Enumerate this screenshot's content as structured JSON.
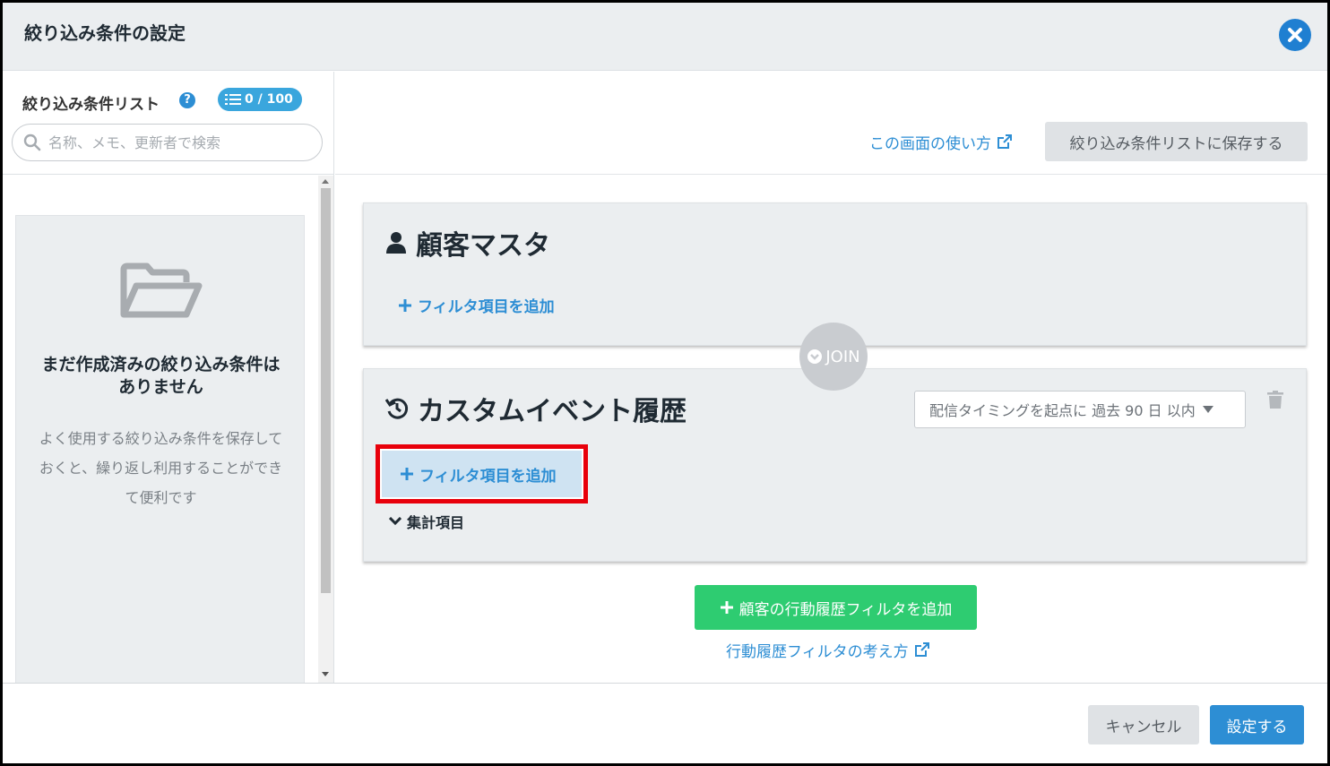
{
  "dialog": {
    "title": "絞り込み条件の設定"
  },
  "sidebar": {
    "title": "絞り込み条件リスト",
    "count_badge": "0 / 100",
    "search_placeholder": "名称、メモ、更新者で検索",
    "empty_title": "まだ作成済みの絞り込み条件はありません",
    "empty_description": "よく使用する絞り込み条件を保存しておくと、繰り返し利用することができて便利です"
  },
  "toolbar": {
    "howto_link": "この画面の使い方",
    "save_to_list_label": "絞り込み条件リストに保存する"
  },
  "cards": [
    {
      "title": "顧客マスタ",
      "add_filter_label": "フィルタ項目を追加"
    },
    {
      "title": "カスタムイベント履歴",
      "add_filter_label": "フィルタ項目を追加",
      "timing_select_value": "配信タイミングを起点に 過去 90 日 以内",
      "aggregate_label": "集計項目"
    }
  ],
  "join_label": "JOIN",
  "add_behavior_filter_label": "顧客の行動履歴フィルタを追加",
  "behavior_filter_help_link": "行動履歴フィルタの考え方",
  "footer": {
    "cancel_label": "キャンセル",
    "submit_label": "設定する"
  },
  "colors": {
    "accent_blue": "#2d8ed4",
    "success_green": "#2ecc71",
    "highlight_red": "#e8000b",
    "panel_gray": "#ebeef0"
  },
  "icons": [
    "close-icon",
    "help-icon",
    "list-icon",
    "search-icon",
    "folder-open-icon",
    "external-link-icon",
    "user-icon",
    "history-icon",
    "plus-icon",
    "chevron-down-icon",
    "caret-down-icon",
    "trash-icon",
    "check-circle-icon"
  ]
}
